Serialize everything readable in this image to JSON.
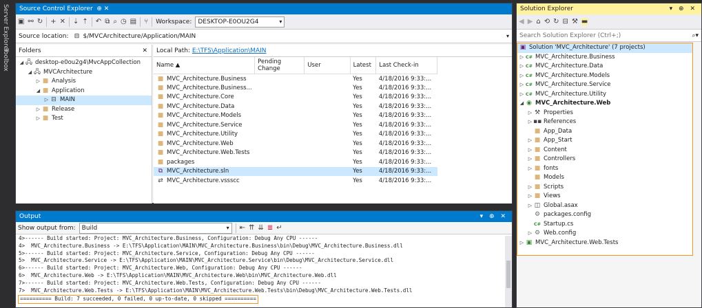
{
  "side_tabs": [
    "Server Explorer",
    "Toolbox"
  ],
  "sce": {
    "title": "Source Control Explorer",
    "pin": "⊕ ✕",
    "workspace_label": "Workspace:",
    "workspace_value": "DESKTOP-E0OU2G4",
    "source_location_label": "Source location:",
    "source_location_value": "$/MVCArchitecture/Application/MAIN",
    "folders_label": "Folders",
    "local_path_label": "Local Path:",
    "local_path_value": "E:\\TFS\\Application\\MAIN",
    "folders": [
      {
        "label": "desktop-e0ou2g4\\MvcAppCollection",
        "depth": 0,
        "exp": "◢",
        "icon": "server"
      },
      {
        "label": "MVCArchitecture",
        "depth": 1,
        "exp": "◢",
        "icon": "server"
      },
      {
        "label": "Analysis",
        "depth": 2,
        "exp": "▷",
        "icon": "folder"
      },
      {
        "label": "Application",
        "depth": 2,
        "exp": "◢",
        "icon": "folder"
      },
      {
        "label": "MAIN",
        "depth": 3,
        "exp": "▷",
        "icon": "branch",
        "selected": true
      },
      {
        "label": "Release",
        "depth": 2,
        "exp": "▷",
        "icon": "folder"
      },
      {
        "label": "Test",
        "depth": 2,
        "exp": "▷",
        "icon": "folder"
      }
    ],
    "columns": [
      "Name ▲",
      "Pending Change",
      "User",
      "Latest",
      "Last Check-in"
    ],
    "files": [
      {
        "name": "MVC_Architecture.Business",
        "latest": "Yes",
        "checkin": "4/18/2016 9:33:..."
      },
      {
        "name": "MVC_Architecture.Business...",
        "latest": "Yes",
        "checkin": "4/18/2016 9:33:..."
      },
      {
        "name": "MVC_Architecture.Core",
        "latest": "Yes",
        "checkin": "4/18/2016 9:33:..."
      },
      {
        "name": "MVC_Architecture.Data",
        "latest": "Yes",
        "checkin": "4/18/2016 9:33:..."
      },
      {
        "name": "MVC_Architecture.Models",
        "latest": "Yes",
        "checkin": "4/18/2016 9:33:..."
      },
      {
        "name": "MVC_Architecture.Service",
        "latest": "Yes",
        "checkin": "4/18/2016 9:33:..."
      },
      {
        "name": "MVC_Architecture.Utility",
        "latest": "Yes",
        "checkin": "4/18/2016 9:33:..."
      },
      {
        "name": "MVC_Architecture.Web",
        "latest": "Yes",
        "checkin": "4/18/2016 9:33:..."
      },
      {
        "name": "MVC_Architecture.Web.Tests",
        "latest": "Yes",
        "checkin": "4/18/2016 9:33:..."
      },
      {
        "name": "packages",
        "latest": "Yes",
        "checkin": "4/18/2016 9:33:..."
      },
      {
        "name": "MVC_Architecture.sln",
        "latest": "Yes",
        "checkin": "4/18/2016 9:33:...",
        "selected": true,
        "icon": "sln"
      },
      {
        "name": "MVC_Architecture.vssscc",
        "latest": "Yes",
        "checkin": "4/18/2016 9:33:...",
        "icon": "vssscc"
      }
    ]
  },
  "output": {
    "title": "Output",
    "ctrls": "▾ ⊕ ✕",
    "show_label": "Show output from:",
    "show_value": "Build",
    "lines": [
      "4>------ Build started: Project: MVC_Architecture.Business, Configuration: Debug Any CPU ------",
      "4>  MVC_Architecture.Business -> E:\\TFS\\Application\\MAIN\\MVC_Architecture.Business\\bin\\Debug\\MVC_Architecture.Business.dll",
      "5>------ Build started: Project: MVC_Architecture.Service, Configuration: Debug Any CPU ------",
      "5>  MVC_Architecture.Service -> E:\\TFS\\Application\\MAIN\\MVC_Architecture.Service\\bin\\Debug\\MVC_Architecture.Service.dll",
      "6>------ Build started: Project: MVC_Architecture.Web, Configuration: Debug Any CPU ------",
      "6>  MVC_Architecture.Web -> E:\\TFS\\Application\\MAIN\\MVC_Architecture.Web\\bin\\MVC_Architecture.Web.dll",
      "7>------ Build started: Project: MVC_Architecture.Web.Tests, Configuration: Debug Any CPU ------",
      "7>  MVC_Architecture.Web.Tests -> E:\\TFS\\Application\\MAIN\\MVC_Architecture.Web.Tests\\bin\\Debug\\MVC_Architecture.Web.Tests.dll"
    ],
    "summary": "========== Build: 7 succeeded, 0 failed, 0 up-to-date, 0 skipped =========="
  },
  "solution": {
    "title": "Solution Explorer",
    "ctrls": "▾ ⊕ ✕",
    "search_placeholder": "Search Solution Explorer (Ctrl+;)",
    "root": "Solution 'MVC_Architecture' (7 projects)",
    "items": [
      {
        "label": "MVC_Architecture.Business",
        "depth": 1,
        "exp": "▷",
        "icon": "cs"
      },
      {
        "label": "MVC_Architecture.Data",
        "depth": 1,
        "exp": "▷",
        "icon": "cs"
      },
      {
        "label": "MVC_Architecture.Models",
        "depth": 1,
        "exp": "▷",
        "icon": "cs"
      },
      {
        "label": "MVC_Architecture.Service",
        "depth": 1,
        "exp": "▷",
        "icon": "cs"
      },
      {
        "label": "MVC_Architecture.Utility",
        "depth": 1,
        "exp": "▷",
        "icon": "cs"
      },
      {
        "label": "MVC_Architecture.Web",
        "depth": 1,
        "exp": "◢",
        "icon": "web",
        "bold": true
      },
      {
        "label": "Properties",
        "depth": 2,
        "exp": "▷",
        "icon": "wrench"
      },
      {
        "label": "References",
        "depth": 2,
        "exp": "▷",
        "icon": "ref"
      },
      {
        "label": "App_Data",
        "depth": 2,
        "exp": "",
        "icon": "folder"
      },
      {
        "label": "App_Start",
        "depth": 2,
        "exp": "▷",
        "icon": "folder"
      },
      {
        "label": "Content",
        "depth": 2,
        "exp": "▷",
        "icon": "folder"
      },
      {
        "label": "Controllers",
        "depth": 2,
        "exp": "▷",
        "icon": "folder"
      },
      {
        "label": "fonts",
        "depth": 2,
        "exp": "▷",
        "icon": "folder"
      },
      {
        "label": "Models",
        "depth": 2,
        "exp": "",
        "icon": "folder"
      },
      {
        "label": "Scripts",
        "depth": 2,
        "exp": "▷",
        "icon": "folder"
      },
      {
        "label": "Views",
        "depth": 2,
        "exp": "▷",
        "icon": "folder"
      },
      {
        "label": "Global.asax",
        "depth": 2,
        "exp": "▷",
        "icon": "asax"
      },
      {
        "label": "packages.config",
        "depth": 2,
        "exp": "",
        "icon": "config"
      },
      {
        "label": "Startup.cs",
        "depth": 2,
        "exp": "",
        "icon": "csfile"
      },
      {
        "label": "Web.config",
        "depth": 2,
        "exp": "▷",
        "icon": "config"
      },
      {
        "label": "MVC_Architecture.Web.Tests",
        "depth": 1,
        "exp": "▷",
        "icon": "test"
      }
    ]
  }
}
